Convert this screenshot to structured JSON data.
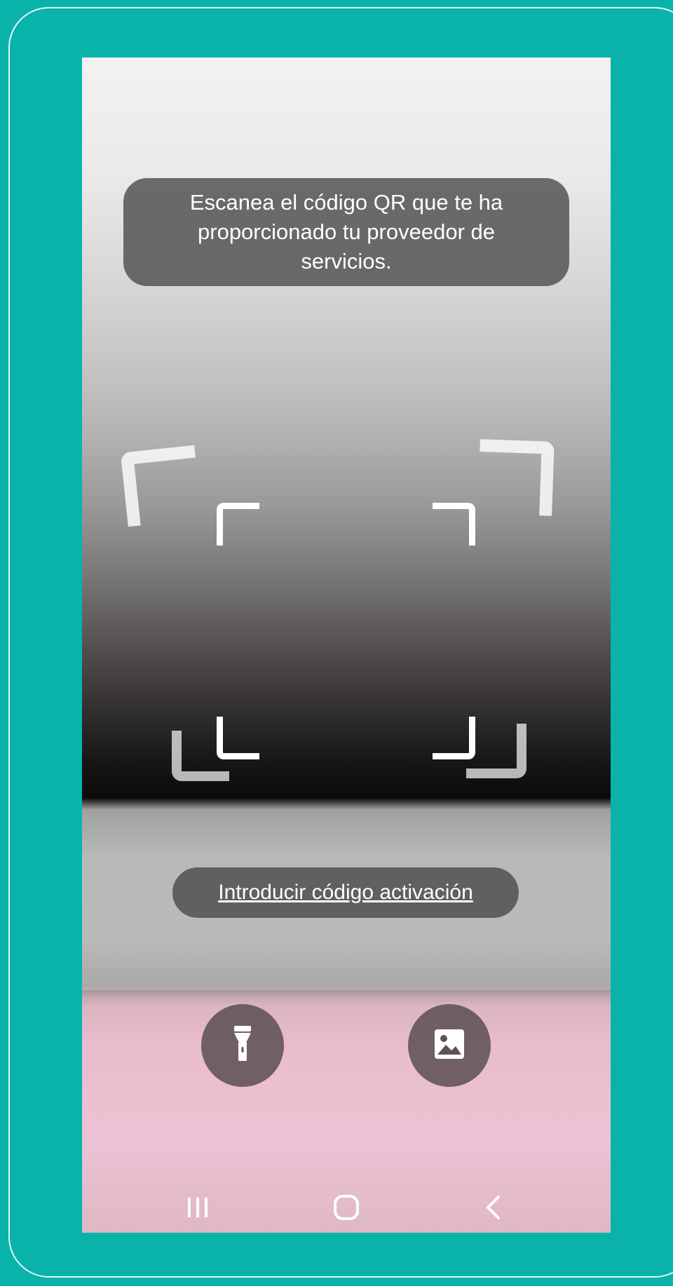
{
  "scanner": {
    "instruction": "Escanea el código QR que te ha proporcionado tu proveedor de servicios.",
    "activation_link": "Introducir código activación"
  },
  "controls": {
    "flashlight_icon": "flashlight-icon",
    "gallery_icon": "image-gallery-icon"
  },
  "navbar": {
    "recents_icon": "recent-apps-icon",
    "home_icon": "home-icon",
    "back_icon": "back-icon"
  },
  "colors": {
    "background": "#0ab3aa",
    "overlay": "#585858",
    "frame": "#ffffff"
  }
}
